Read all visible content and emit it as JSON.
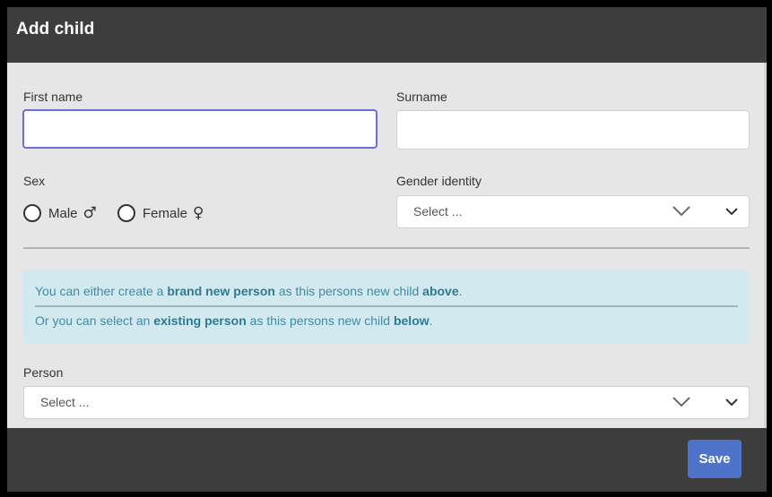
{
  "dialog": {
    "title": "Add child"
  },
  "form": {
    "first_name": {
      "label": "First name",
      "value": "",
      "placeholder": ""
    },
    "surname": {
      "label": "Surname",
      "value": "",
      "placeholder": ""
    },
    "sex": {
      "label": "Sex",
      "options": [
        {
          "label": "Male",
          "glyph": "♂",
          "selected": false
        },
        {
          "label": "Female",
          "glyph": "♀",
          "selected": false
        }
      ]
    },
    "gender_identity": {
      "label": "Gender identity",
      "placeholder": "Select ..."
    },
    "person": {
      "label": "Person",
      "placeholder": "Select ..."
    }
  },
  "info": {
    "line1": {
      "pre": "You can either create a ",
      "strong1": "brand new person",
      "mid": " as this persons new child ",
      "strong2": "above",
      "post": "."
    },
    "line2": {
      "pre": "Or you can select an ",
      "strong1": "existing person",
      "mid": " as this persons new child ",
      "strong2": "below",
      "post": "."
    }
  },
  "footer": {
    "save_label": "Save"
  },
  "colors": {
    "header_bg": "#3d3d3d",
    "body_bg": "#e6e6e6",
    "focus_border": "#6e6fd6",
    "info_bg": "#d2e9f0",
    "info_text": "#3f8ba3",
    "save_bg": "#4f73c8"
  },
  "icons": {
    "select_chevron": "chevron-down-icon"
  }
}
